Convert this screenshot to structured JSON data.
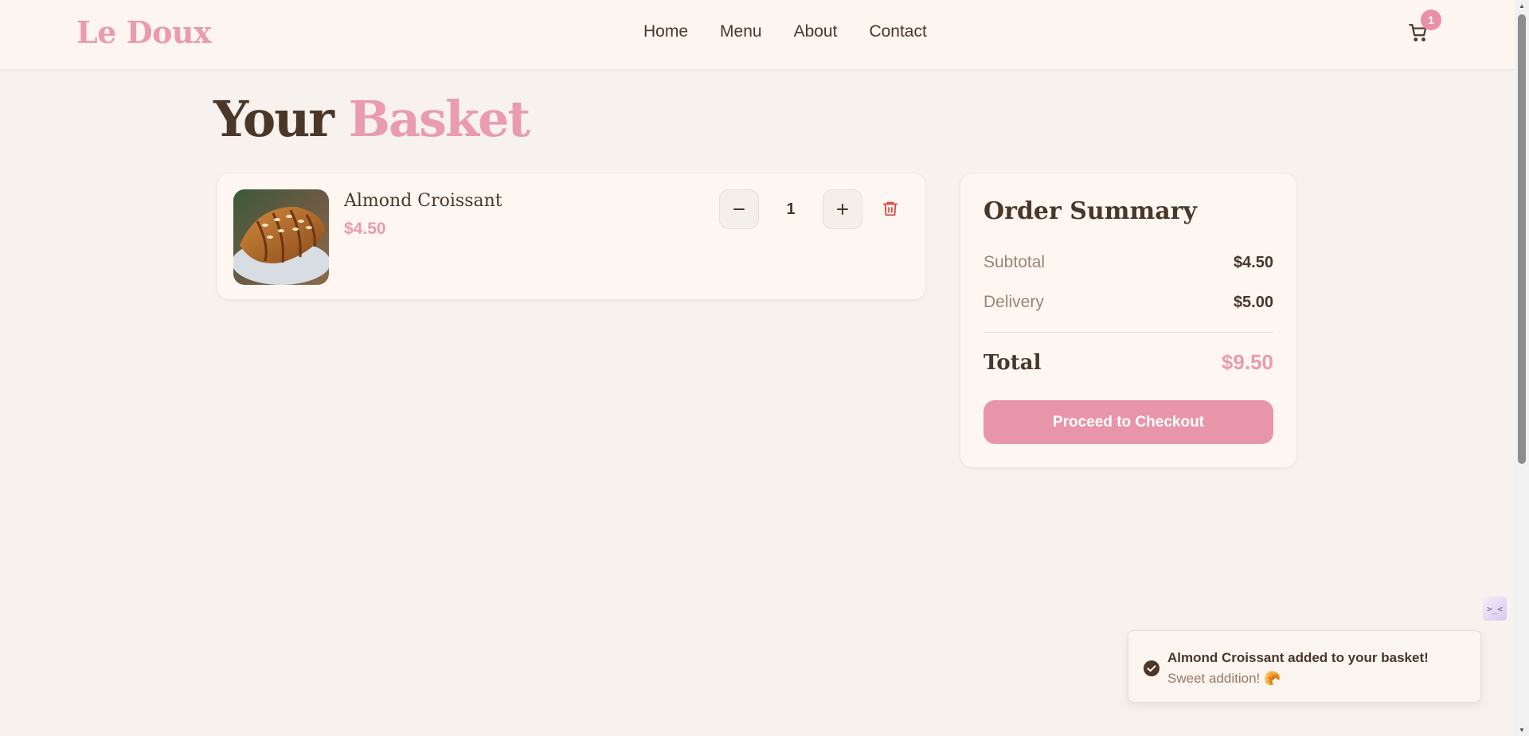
{
  "brand": {
    "name": "Le Doux",
    "accent_color": "#ea9bb0",
    "text_color": "#4a3728"
  },
  "nav": {
    "items": [
      {
        "label": "Home"
      },
      {
        "label": "Menu"
      },
      {
        "label": "About"
      },
      {
        "label": "Contact"
      }
    ],
    "cart_icon": "cart-icon",
    "cart_count": "1"
  },
  "page": {
    "title_part1": "Your",
    "title_part2": "Basket"
  },
  "basket": {
    "items": [
      {
        "name": "Almond Croissant",
        "price": "$4.50",
        "quantity": "1",
        "image": "almond-croissant-photo"
      }
    ],
    "minus_icon": "minus-icon",
    "plus_icon": "plus-icon",
    "delete_icon": "trash-icon"
  },
  "summary": {
    "title": "Order Summary",
    "subtotal_label": "Subtotal",
    "subtotal_value": "$4.50",
    "delivery_label": "Delivery",
    "delivery_value": "$5.00",
    "total_label": "Total",
    "total_value": "$9.50",
    "checkout_label": "Proceed to Checkout"
  },
  "toast": {
    "title": "Almond Croissant added to your basket!",
    "subtitle": "Sweet addition! 🥐",
    "icon": "check-circle-icon"
  },
  "side_widget": {
    "label": ">_<"
  }
}
